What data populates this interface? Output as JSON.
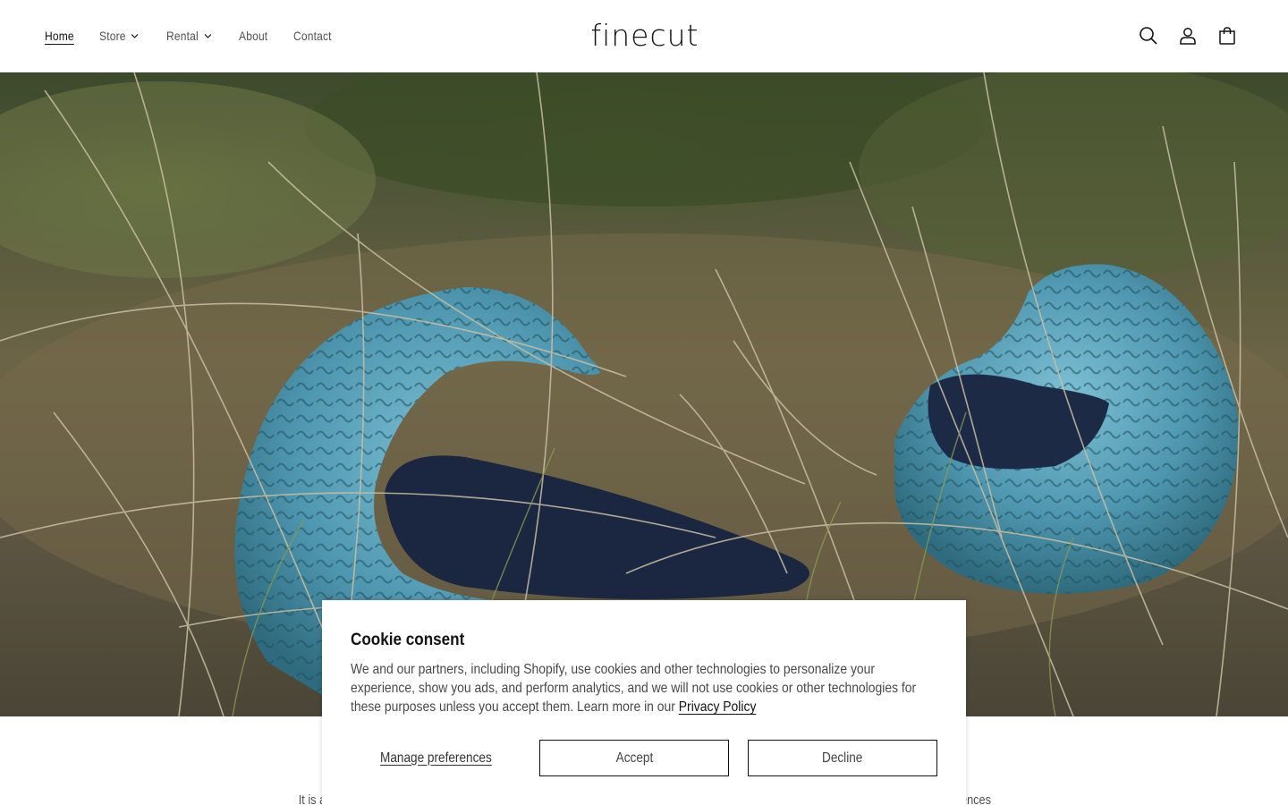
{
  "header": {
    "nav": [
      {
        "label": "Home",
        "active": true,
        "has_dropdown": false
      },
      {
        "label": "Store",
        "active": false,
        "has_dropdown": true
      },
      {
        "label": "Rental",
        "active": false,
        "has_dropdown": true
      },
      {
        "label": "About",
        "active": false,
        "has_dropdown": false
      },
      {
        "label": "Contact",
        "active": false,
        "has_dropdown": false
      }
    ],
    "logo": "finecut",
    "icons": [
      "search-icon",
      "account-icon",
      "cart-icon"
    ]
  },
  "hero": {
    "image": "Two blue textured ceramic bird-shaped bowls nestled in dry grass"
  },
  "below": {
    "text_left": "It is a",
    "text_right": "ences"
  },
  "cookie": {
    "title": "Cookie consent",
    "body": "We and our partners, including Shopify, use cookies and other technologies to personalize your experience, show you ads, and perform analytics, and we will not use cookies or other technologies for these purposes unless you accept them. Learn more in our ",
    "link": "Privacy Policy",
    "manage": "Manage preferences",
    "accept": "Accept",
    "decline": "Decline"
  },
  "colors": {
    "text": "#121212",
    "ceramic": "#5aa0b8",
    "border": "#121212"
  }
}
